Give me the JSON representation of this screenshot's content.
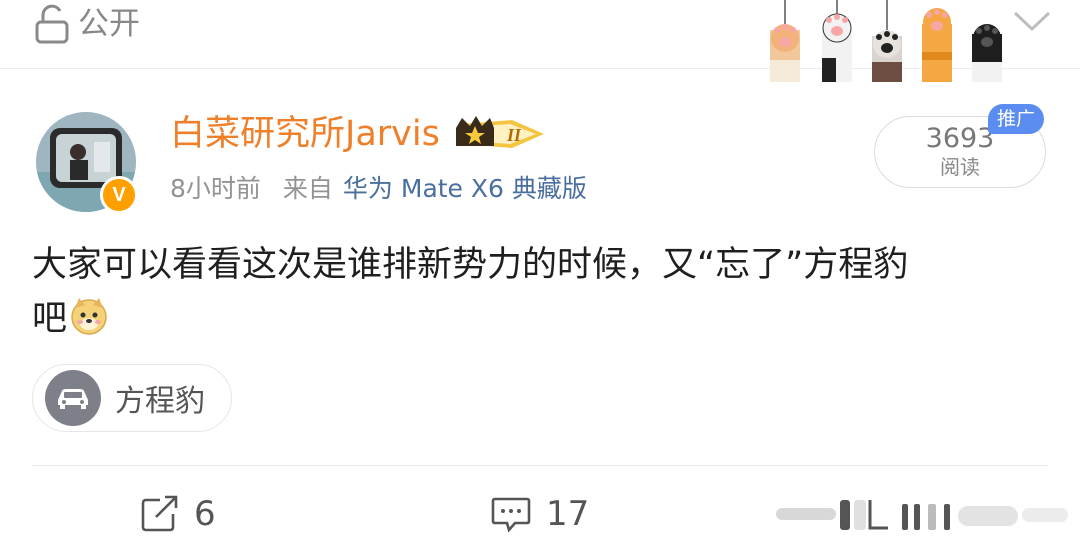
{
  "topbar": {
    "visibility_label": "公开"
  },
  "author": {
    "name": "白菜研究所Jarvis",
    "level_badge": "II",
    "verified_mark": "V"
  },
  "meta": {
    "time": "8小时前",
    "from_label": "来自",
    "device": "华为 Mate X6 典藏版"
  },
  "stats": {
    "read_count": "3693",
    "read_label": "阅读",
    "promo_label": "推广"
  },
  "post": {
    "line1": "大家可以看看这次是谁排新势力的时候，又“忘了”方程豹",
    "line2": "吧"
  },
  "topic": {
    "label": "方程豹"
  },
  "actions": {
    "repost_count": "6",
    "comment_count": "17"
  },
  "colors": {
    "author_name": "#f07f2a",
    "device_link": "#4a6f9e",
    "promo": "#5b8df0",
    "verified": "#ff9f00"
  },
  "icons": {
    "visibility": "lock-open-icon",
    "collapse": "chevron-down-icon",
    "repost": "repost-icon",
    "comment": "comment-icon",
    "topic": "car-icon",
    "emoji": "doge-emoji"
  }
}
